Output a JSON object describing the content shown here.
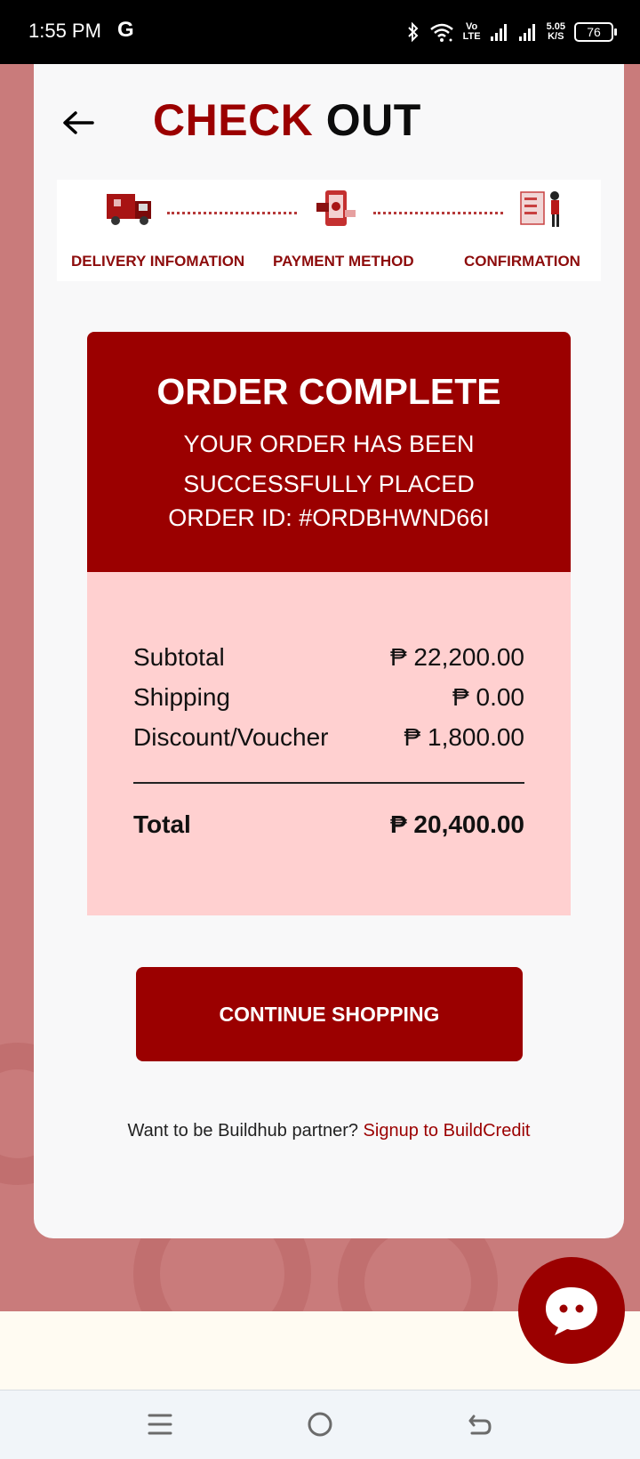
{
  "status_bar": {
    "time": "1:55 PM",
    "carrier_icon": "G",
    "volte_top": "Vo",
    "volte_bottom": "LTE",
    "speed_top": "5.05",
    "speed_bottom": "K/S",
    "battery": "76"
  },
  "header": {
    "title_part1": "CHECK",
    "title_part2": "OUT",
    "back_icon": "arrow-left-icon"
  },
  "stepper": {
    "steps": [
      {
        "label": "DELIVERY INFOMATION",
        "icon": "delivery-truck-icon"
      },
      {
        "label": "PAYMENT METHOD",
        "icon": "payment-phone-icon"
      },
      {
        "label": "CONFIRMATION",
        "icon": "confirmation-checklist-icon"
      }
    ]
  },
  "order": {
    "title": "ORDER COMPLETE",
    "subtitle": "YOUR ORDER HAS BEEN SUCCESSFULLY PLACED",
    "order_id": "ORDER ID: #ORDBHWND66I"
  },
  "summary": {
    "subtotal_label": "Subtotal",
    "subtotal_value": "₱ 22,200.00",
    "shipping_label": "Shipping",
    "shipping_value": "₱ 0.00",
    "discount_label": "Discount/Voucher",
    "discount_value": "₱ 1,800.00",
    "total_label": "Total",
    "total_value": "₱ 20,400.00"
  },
  "actions": {
    "continue_label": "CONTINUE SHOPPING"
  },
  "partner": {
    "text": "Want to be Buildhub partner?",
    "link": "Signup to BuildCredit"
  },
  "colors": {
    "brand_red": "#9b0000",
    "summary_bg": "#ffd0d0",
    "page_bg": "#c87a7a"
  }
}
